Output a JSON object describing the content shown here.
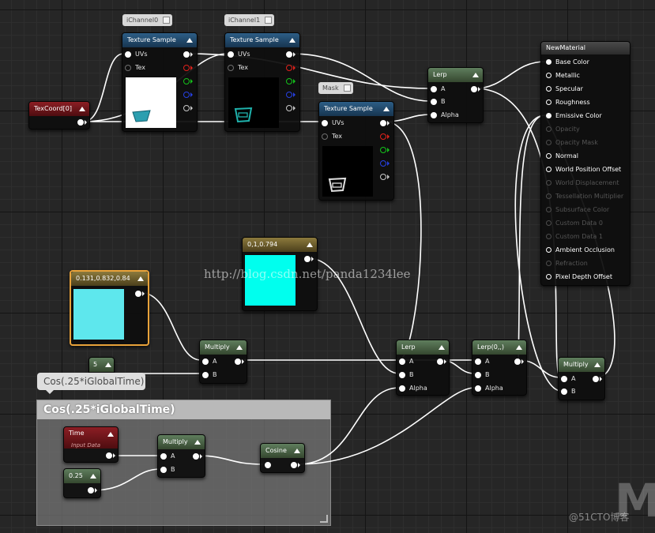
{
  "editor": {
    "watermark": "http://blog.csdn.net/panda1234lee",
    "corner_text": "@51CTO博客",
    "corner_logo": "M"
  },
  "comment_group": {
    "title": "Cos(.25*iGlobalTime)",
    "bubble": "Cos(.25*iGlobalTime)"
  },
  "tags": {
    "ichannel0": "iChannel0",
    "ichannel1": "iChannel1",
    "mask": "Mask"
  },
  "nodes": {
    "texcoord": {
      "title": "TexCoord[0]"
    },
    "tex_sample_1": {
      "title": "Texture Sample",
      "inputs": [
        "UVs",
        "Tex"
      ]
    },
    "tex_sample_2": {
      "title": "Texture Sample",
      "inputs": [
        "UVs",
        "Tex"
      ]
    },
    "tex_sample_3": {
      "title": "Texture Sample",
      "inputs": [
        "UVs",
        "Tex"
      ]
    },
    "lerp_top": {
      "title": "Lerp",
      "inputs": [
        "A",
        "B",
        "Alpha"
      ]
    },
    "const3_cyan": {
      "title": "0,1,0.794",
      "color": "#00ffee"
    },
    "const3_light": {
      "title": "0.131,0.832,0.84",
      "color": "#5ee7ed"
    },
    "multiply_1": {
      "title": "Multiply",
      "inputs": [
        "A",
        "B"
      ]
    },
    "const_5": {
      "title": "5"
    },
    "lerp_mid": {
      "title": "Lerp",
      "inputs": [
        "A",
        "B",
        "Alpha"
      ]
    },
    "lerp_0": {
      "title": "Lerp(0,,)",
      "inputs": [
        "A",
        "B",
        "Alpha"
      ]
    },
    "multiply_final": {
      "title": "Multiply",
      "inputs": [
        "A",
        "B"
      ]
    },
    "time": {
      "title": "Time",
      "subtitle": "Input Data"
    },
    "const_025": {
      "title": "0.25"
    },
    "multiply_time": {
      "title": "Multiply",
      "inputs": [
        "A",
        "B"
      ]
    },
    "cosine": {
      "title": "Cosine"
    },
    "material": {
      "title": "NewMaterial",
      "pins": [
        {
          "label": "Base Color",
          "enabled": true
        },
        {
          "label": "Metallic",
          "enabled": true
        },
        {
          "label": "Specular",
          "enabled": true
        },
        {
          "label": "Roughness",
          "enabled": true
        },
        {
          "label": "Emissive Color",
          "enabled": true
        },
        {
          "label": "Opacity",
          "enabled": false
        },
        {
          "label": "Opacity Mask",
          "enabled": false
        },
        {
          "label": "Normal",
          "enabled": true
        },
        {
          "label": "World Position Offset",
          "enabled": true
        },
        {
          "label": "World Displacement",
          "enabled": false
        },
        {
          "label": "Tessellation Multiplier",
          "enabled": false
        },
        {
          "label": "Subsurface Color",
          "enabled": false
        },
        {
          "label": "Custom Data 0",
          "enabled": false
        },
        {
          "label": "Custom Data 1",
          "enabled": false
        },
        {
          "label": "Ambient Occlusion",
          "enabled": true
        },
        {
          "label": "Refraction",
          "enabled": false
        },
        {
          "label": "Pixel Depth Offset",
          "enabled": true
        }
      ]
    }
  },
  "colors": {
    "wire": "#ffffff",
    "selection": "#e8a23a",
    "texture_header": "#2d5e86",
    "math_header": "#5f7e5d",
    "input_header": "#8c1e24",
    "vector_header": "#8c7a3d"
  }
}
